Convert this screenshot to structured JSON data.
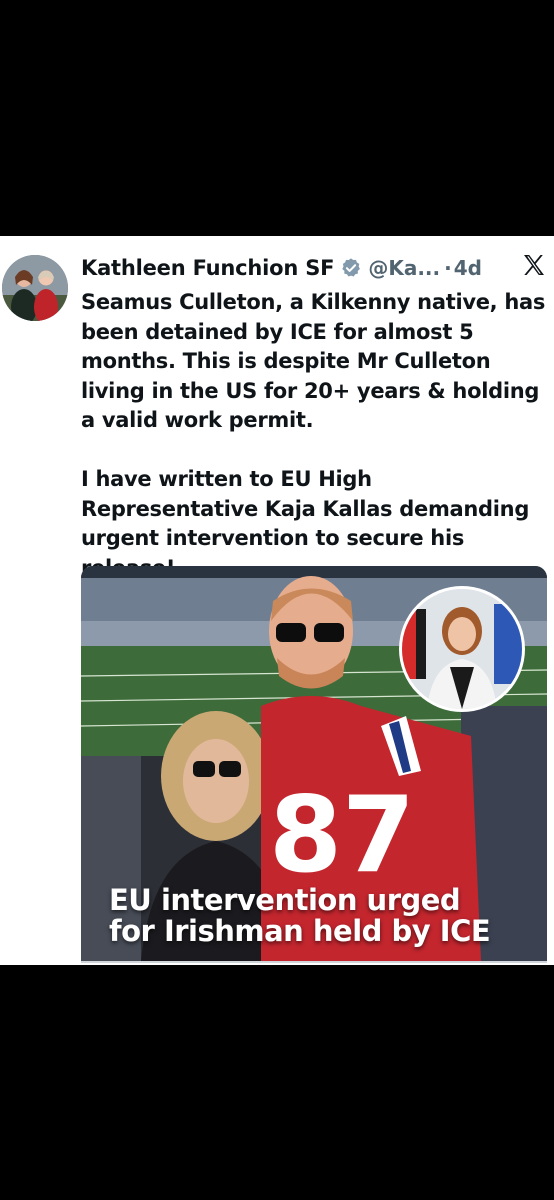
{
  "post": {
    "author_name": "Kathleen Funchion SF",
    "handle": "@Ka...",
    "separator": "·",
    "time_ago": "4d",
    "paragraphs": [
      "Seamus Culleton, a Kilkenny native, has been detained by ICE for almost 5 months. This is despite Mr Culleton living in the US for 20+ years & holding a valid work permit.",
      "I have written to EU High Representative Kaja Kallas demanding urgent intervention to secure his release!"
    ],
    "icons": {
      "verified": "verified-badge-icon",
      "platform": "x-logo-icon"
    },
    "colors": {
      "verified": "#829aab",
      "text": "#0f1419",
      "muted": "#536471"
    }
  },
  "media": {
    "caption_line1": "EU intervention urged",
    "caption_line2": "for Irishman held by ICE",
    "jersey_number": "87"
  }
}
